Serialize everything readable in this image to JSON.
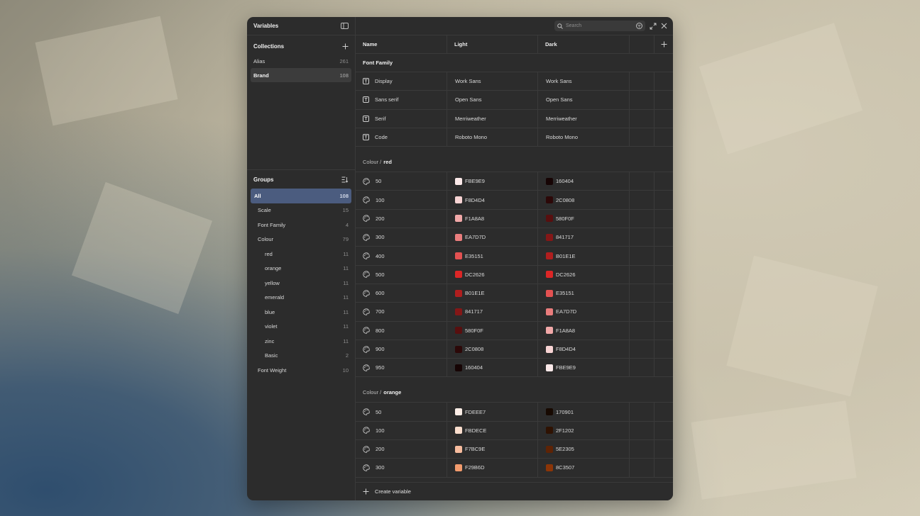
{
  "sidebar": {
    "title": "Variables",
    "collections_label": "Collections",
    "collections": [
      {
        "label": "Alias",
        "count": "261"
      },
      {
        "label": "Brand",
        "count": "108"
      }
    ],
    "groups_label": "Groups",
    "groups": [
      {
        "label": "All",
        "count": "108",
        "level": 0
      },
      {
        "label": "Scale",
        "count": "15",
        "level": 1
      },
      {
        "label": "Font Family",
        "count": "4",
        "level": 1
      },
      {
        "label": "Colour",
        "count": "79",
        "level": 1
      },
      {
        "label": "red",
        "count": "11",
        "level": 2
      },
      {
        "label": "orange",
        "count": "11",
        "level": 2
      },
      {
        "label": "yellow",
        "count": "11",
        "level": 2
      },
      {
        "label": "emerald",
        "count": "11",
        "level": 2
      },
      {
        "label": "blue",
        "count": "11",
        "level": 2
      },
      {
        "label": "violet",
        "count": "11",
        "level": 2
      },
      {
        "label": "zinc",
        "count": "11",
        "level": 2
      },
      {
        "label": "Basic",
        "count": "2",
        "level": 2
      },
      {
        "label": "Font Weight",
        "count": "10",
        "level": 1
      }
    ]
  },
  "topbar": {
    "search_placeholder": "Search"
  },
  "columns": {
    "name": "Name",
    "light": "Light",
    "dark": "Dark"
  },
  "font_family": {
    "title": "Font Family",
    "rows": [
      {
        "name": "Display",
        "light": "Work Sans",
        "dark": "Work Sans"
      },
      {
        "name": "Sans serif",
        "light": "Open Sans",
        "dark": "Open Sans"
      },
      {
        "name": "Serif",
        "light": "Merriweather",
        "dark": "Merriweather"
      },
      {
        "name": "Code",
        "light": "Roboto Mono",
        "dark": "Roboto Mono"
      }
    ]
  },
  "colour_red": {
    "prefix": "Colour /",
    "title": "red",
    "rows": [
      {
        "name": "50",
        "light": "FBE9E9",
        "dark": "160404"
      },
      {
        "name": "100",
        "light": "F8D4D4",
        "dark": "2C0808"
      },
      {
        "name": "200",
        "light": "F1A8A8",
        "dark": "580F0F"
      },
      {
        "name": "300",
        "light": "EA7D7D",
        "dark": "841717"
      },
      {
        "name": "400",
        "light": "E35151",
        "dark": "B01E1E"
      },
      {
        "name": "500",
        "light": "DC2626",
        "dark": "DC2626"
      },
      {
        "name": "600",
        "light": "B01E1E",
        "dark": "E35151"
      },
      {
        "name": "700",
        "light": "841717",
        "dark": "EA7D7D"
      },
      {
        "name": "800",
        "light": "580F0F",
        "dark": "F1A8A8"
      },
      {
        "name": "900",
        "light": "2C0808",
        "dark": "F8D4D4"
      },
      {
        "name": "950",
        "light": "160404",
        "dark": "FBE9E9"
      }
    ]
  },
  "colour_orange": {
    "prefix": "Colour /",
    "title": "orange",
    "rows": [
      {
        "name": "50",
        "light": "FDEEE7",
        "dark": "170901"
      },
      {
        "name": "100",
        "light": "FBDECE",
        "dark": "2F1202"
      },
      {
        "name": "200",
        "light": "F7BC9E",
        "dark": "5E2305"
      },
      {
        "name": "300",
        "light": "F29B6D",
        "dark": "8C3507"
      }
    ]
  },
  "footer": {
    "create_label": "Create variable"
  }
}
